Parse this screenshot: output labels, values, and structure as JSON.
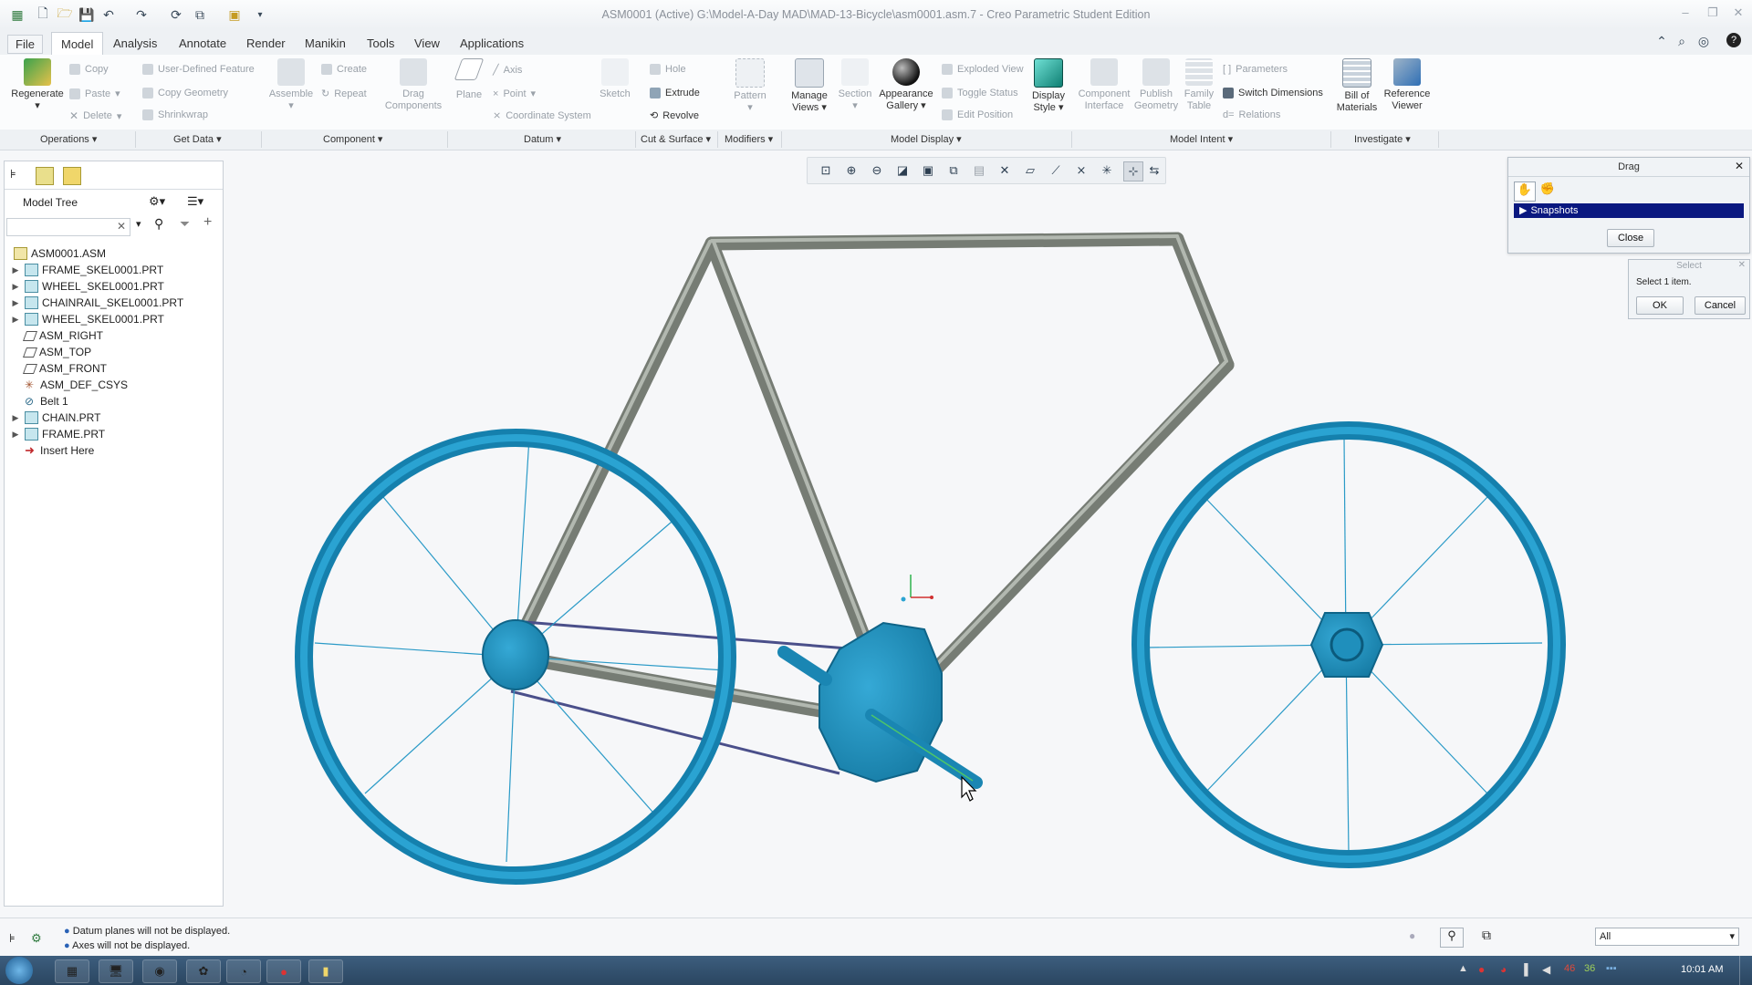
{
  "window": {
    "title": "ASM0001 (Active) G:\\Model-A-Day MAD\\MAD-13-Bicycle\\asm0001.asm.7 - Creo Parametric Student Edition"
  },
  "menu_tabs": [
    "File",
    "Model",
    "Analysis",
    "Annotate",
    "Render",
    "Manikin",
    "Tools",
    "View",
    "Applications"
  ],
  "ribbon": {
    "regenerate": "Regenerate",
    "copy": "Copy",
    "paste": "Paste",
    "delete": "Delete",
    "user_defined_feature": "User-Defined Feature",
    "copy_geometry": "Copy Geometry",
    "shrinkwrap": "Shrinkwrap",
    "assemble": "Assemble",
    "create": "Create",
    "repeat": "Repeat",
    "drag_components": "Drag Components",
    "plane": "Plane",
    "axis": "Axis",
    "point": "Point",
    "coordinate_system": "Coordinate System",
    "sketch": "Sketch",
    "hole": "Hole",
    "extrude": "Extrude",
    "revolve": "Revolve",
    "pattern": "Pattern",
    "manage_views": "Manage Views",
    "section": "Section",
    "appearance_gallery": "Appearance Gallery",
    "exploded_view": "Exploded View",
    "toggle_status": "Toggle Status",
    "edit_position": "Edit Position",
    "display_style": "Display Style",
    "component_interface": "Component Interface",
    "publish_geometry": "Publish Geometry",
    "family_table": "Family Table",
    "parameters": "Parameters",
    "switch_dimensions": "Switch Dimensions",
    "relations": "Relations",
    "bill_of_materials": "Bill of Materials",
    "reference_viewer": "Reference Viewer"
  },
  "groups": [
    "Operations",
    "Get Data",
    "Component",
    "Datum",
    "Cut & Surface",
    "Modifiers",
    "Model Display",
    "Model Intent",
    "Investigate"
  ],
  "model_tree": {
    "title": "Model Tree",
    "items": [
      "ASM0001.ASM",
      "FRAME_SKEL0001.PRT",
      "WHEEL_SKEL0001.PRT",
      "CHAINRAIL_SKEL0001.PRT",
      "WHEEL_SKEL0001.PRT",
      "ASM_RIGHT",
      "ASM_TOP",
      "ASM_FRONT",
      "ASM_DEF_CSYS",
      "Belt 1",
      "CHAIN.PRT",
      "FRAME.PRT",
      "Insert Here"
    ]
  },
  "drag_dialog": {
    "title": "Drag",
    "snapshots": "Snapshots",
    "close": "Close"
  },
  "select_dialog": {
    "title": "Select",
    "message": "Select 1 item.",
    "ok": "OK",
    "cancel": "Cancel"
  },
  "status": {
    "messages": [
      "Datum planes will not be displayed.",
      "Axes will not be displayed."
    ],
    "filter": "All"
  },
  "taskbar": {
    "tray_numbers": [
      "46",
      "36"
    ],
    "clock": "10:01 AM"
  },
  "colors": {
    "part_blue": "#1b8fbd",
    "frame_gray": "#8a9189",
    "selection": "#0a1880"
  }
}
